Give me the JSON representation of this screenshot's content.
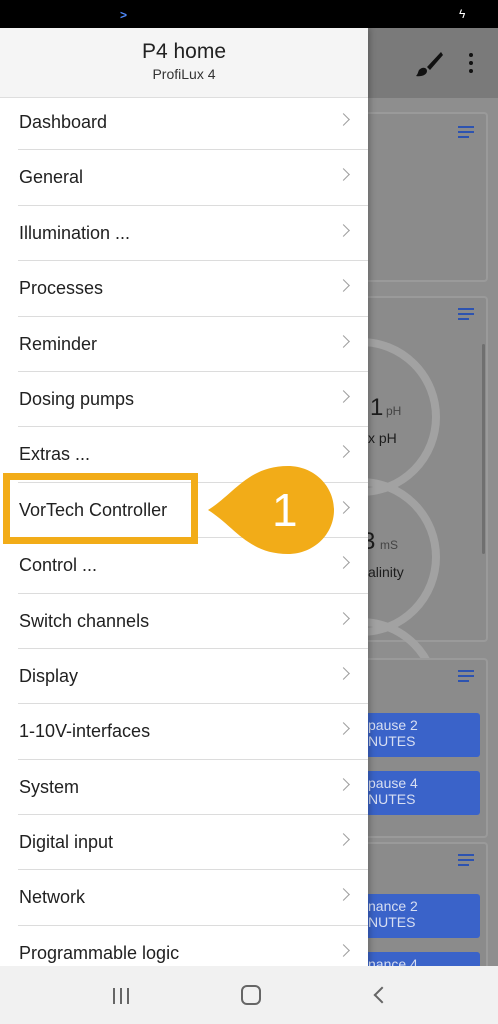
{
  "status_bar": {
    "left_icon": "chevron-icon",
    "right_icon": "bolt-icon"
  },
  "drawer": {
    "title": "P4 home",
    "subtitle": "ProfiLux 4",
    "items": [
      {
        "label": "Dashboard"
      },
      {
        "label": "General"
      },
      {
        "label": "Illumination ..."
      },
      {
        "label": "Processes"
      },
      {
        "label": "Reminder"
      },
      {
        "label": "Dosing pumps"
      },
      {
        "label": "Extras ..."
      },
      {
        "label": "VorTech Controller"
      },
      {
        "label": "Control ..."
      },
      {
        "label": "Switch channels"
      },
      {
        "label": "Display"
      },
      {
        "label": "1-10V-interfaces"
      },
      {
        "label": "System"
      },
      {
        "label": "Digital input"
      },
      {
        "label": "Network"
      },
      {
        "label": "Programmable logic"
      }
    ]
  },
  "callout": {
    "number": "1",
    "color": "#f2ac18"
  },
  "background": {
    "gauges": [
      {
        "value": "1",
        "unit": "pH",
        "label": "x pH"
      },
      {
        "value": "3",
        "unit": "mS",
        "label": "alinity"
      }
    ],
    "buttons": [
      {
        "line1": "pause 2",
        "line2": "NUTES"
      },
      {
        "line1": "pause 4",
        "line2": "NUTES"
      },
      {
        "line1": "nance 2",
        "line2": "NUTES"
      },
      {
        "line1": "nance 4",
        "line2": ""
      }
    ]
  },
  "navbar": {
    "icons": [
      "recent-apps-icon",
      "home-icon",
      "back-icon"
    ]
  }
}
